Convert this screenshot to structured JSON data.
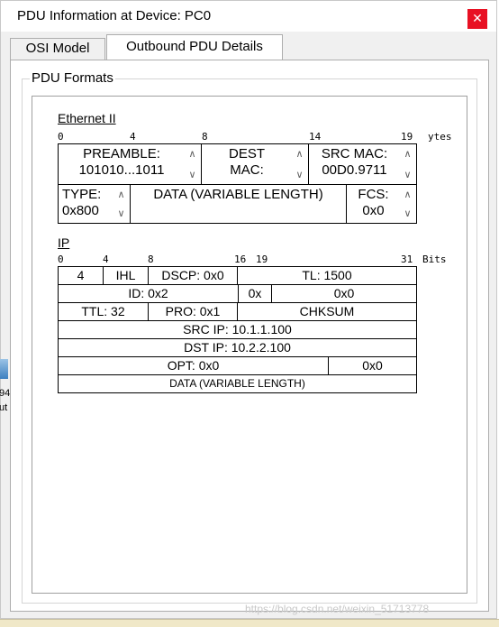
{
  "window": {
    "title": "PDU Information at Device: PC0",
    "close_glyph": "✕"
  },
  "tabs": [
    {
      "label": "OSI Model"
    },
    {
      "label": "Outbound PDU Details"
    }
  ],
  "group": {
    "legend": "PDU Formats"
  },
  "ethernet": {
    "title": "Ethernet II",
    "ruler": {
      "t0": "0",
      "t4": "4",
      "t8": "8",
      "t14": "14",
      "t19": "19",
      "unit": "ytes"
    },
    "preamble": {
      "line1": "PREAMBLE:",
      "line2": "101010...1011"
    },
    "dest": {
      "line1": "DEST",
      "line2": "MAC:"
    },
    "src": {
      "line1": "SRC MAC:",
      "line2": "00D0.9711"
    },
    "type": {
      "line1": "TYPE:",
      "line2": "0x800"
    },
    "data": "DATA (VARIABLE LENGTH)",
    "fcs": {
      "line1": "FCS:",
      "line2": "0x0"
    }
  },
  "ip": {
    "title": "IP",
    "ruler": {
      "t0": "0",
      "t4": "4",
      "t8": "8",
      "t16": "16",
      "t19": "19",
      "t31": "31",
      "unit": "Bits"
    },
    "version": "4",
    "ihl": "IHL",
    "dscp": "DSCP: 0x0",
    "tl": "TL: 1500",
    "id": "ID: 0x2",
    "flags": "0x",
    "frag": "0x0",
    "ttl": "TTL: 32",
    "pro": "PRO: 0x1",
    "chksum": "CHKSUM",
    "src_ip": "SRC IP: 10.1.1.100",
    "dst_ip": "DST IP: 10.2.2.100",
    "opt": "OPT: 0x0",
    "padding": "0x0",
    "data": "DATA (VARIABLE LENGTH)"
  },
  "scroll": {
    "up": "∧",
    "down": "∨"
  },
  "desktop": {
    "label1": "94",
    "label2": "ut"
  },
  "watermark": "https://blog.csdn.net/weixin_51713778"
}
